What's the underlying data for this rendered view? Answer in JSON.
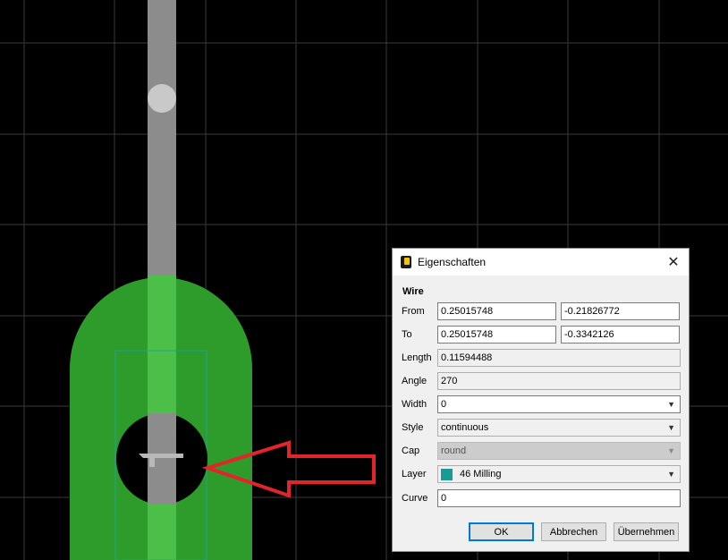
{
  "dialog": {
    "title": "Eigenschaften",
    "close_glyph": "✕",
    "section": "Wire",
    "from": {
      "label": "From",
      "x": "0.25015748",
      "y": "-0.21826772"
    },
    "to": {
      "label": "To",
      "x": "0.25015748",
      "y": "-0.3342126"
    },
    "length": {
      "label": "Length",
      "value": "0.11594488"
    },
    "angle": {
      "label": "Angle",
      "value": "270"
    },
    "width": {
      "label": "Width",
      "value": "0"
    },
    "style": {
      "label": "Style",
      "value": "continuous"
    },
    "cap": {
      "label": "Cap",
      "value": "round"
    },
    "layer": {
      "label": "Layer",
      "value": "46 Milling",
      "color": "#199a94"
    },
    "curve": {
      "label": "Curve",
      "value": "0"
    },
    "buttons": {
      "ok": "OK",
      "cancel": "Abbrechen",
      "apply": "Übernehmen"
    }
  },
  "colors": {
    "background": "#000000",
    "grid": "#3a3a3a",
    "pad": "#2e9c2a",
    "pad_highlight": "#4cbf48",
    "wire": "#8c8c8c",
    "arrow": "#e2252b"
  }
}
